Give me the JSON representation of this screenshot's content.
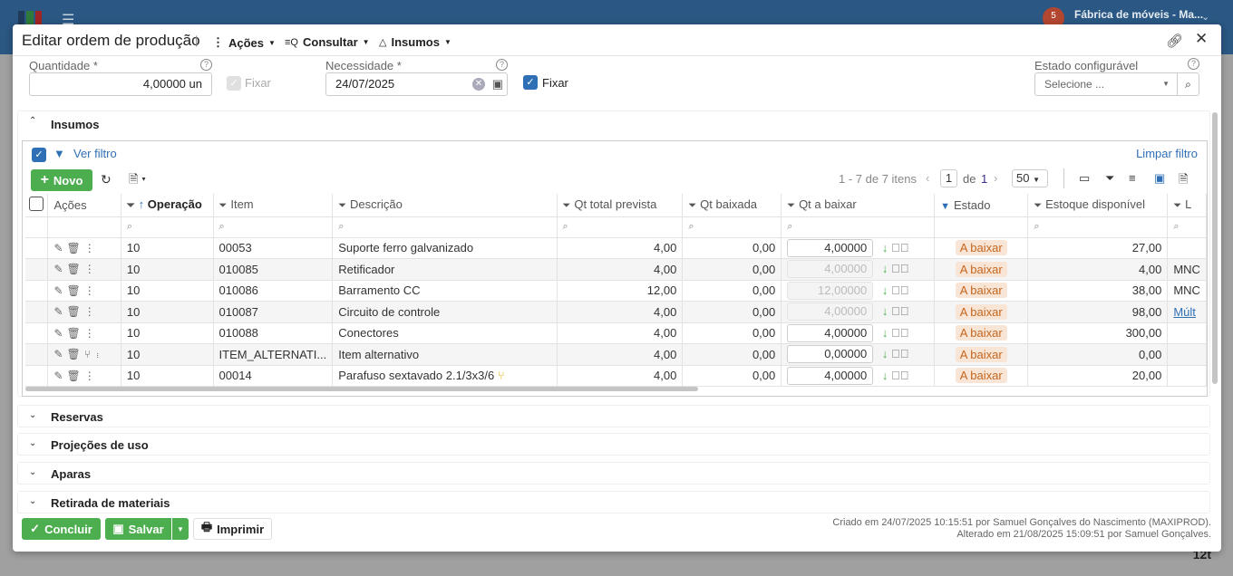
{
  "app": {
    "notifications": "5",
    "company": "Fábrica de móveis - Ma..."
  },
  "background": {
    "number": "12t"
  },
  "modal": {
    "title": "Editar ordem de produção",
    "menu": [
      {
        "label": "Ações"
      },
      {
        "label": "Consultar"
      },
      {
        "label": "Insumos"
      }
    ]
  },
  "form": {
    "quantidade_label": "Quantidade *",
    "quantidade_value": "4,00000 un",
    "fixar1": "Fixar",
    "necessidade_label": "Necessidade *",
    "necessidade_value": "24/07/2025",
    "fixar2": "Fixar",
    "estado_label": "Estado configurável",
    "estado_placeholder": "Selecione ..."
  },
  "insumos": {
    "title": "Insumos",
    "ver_filtro": "Ver filtro",
    "limpar_filtro": "Limpar filtro",
    "novo": "Novo",
    "pager": {
      "range": "1 - 7 de 7 itens",
      "page": "1",
      "of": "de",
      "total": "1",
      "per_page": "50"
    },
    "columns": [
      "Ações",
      "Operação",
      "Item",
      "Descrição",
      "Qt total prevista",
      "Qt baixada",
      "Qt a baixar",
      "Estado",
      "Estoque disponível",
      "L"
    ],
    "rows": [
      {
        "op": "10",
        "item": "00053",
        "desc": "Suporte ferro galvanizado",
        "prev": "4,00",
        "baix": "0,00",
        "abaixar": "4,00000",
        "dis": false,
        "estado": "A baixar",
        "estoque": "27,00",
        "l": ""
      },
      {
        "op": "10",
        "item": "010085",
        "desc": "Retificador",
        "prev": "4,00",
        "baix": "0,00",
        "abaixar": "4,00000",
        "dis": true,
        "estado": "A baixar",
        "estoque": "4,00",
        "l": "MNC"
      },
      {
        "op": "10",
        "item": "010086",
        "desc": "Barramento CC",
        "prev": "12,00",
        "baix": "0,00",
        "abaixar": "12,00000",
        "dis": true,
        "estado": "A baixar",
        "estoque": "38,00",
        "l": "MNC"
      },
      {
        "op": "10",
        "item": "010087",
        "desc": "Circuito de controle",
        "prev": "4,00",
        "baix": "0,00",
        "abaixar": "4,00000",
        "dis": true,
        "estado": "A baixar",
        "estoque": "98,00",
        "l": "Múlt"
      },
      {
        "op": "10",
        "item": "010088",
        "desc": "Conectores",
        "prev": "4,00",
        "baix": "0,00",
        "abaixar": "4,00000",
        "dis": false,
        "estado": "A baixar",
        "estoque": "300,00",
        "l": ""
      },
      {
        "op": "10",
        "item": "ITEM_ALTERNATI...",
        "desc": "Item alternativo",
        "prev": "4,00",
        "baix": "0,00",
        "abaixar": "0,00000",
        "dis": false,
        "estado": "A baixar",
        "estoque": "0,00",
        "l": ""
      },
      {
        "op": "10",
        "item": "00014",
        "desc": "Parafuso sextavado 2.1/3x3/6",
        "prev": "4,00",
        "baix": "0,00",
        "abaixar": "4,00000",
        "dis": false,
        "estado": "A baixar",
        "estoque": "20,00",
        "l": ""
      }
    ]
  },
  "sections": [
    "Reservas",
    "Projeções de uso",
    "Aparas",
    "Retirada de materiais"
  ],
  "footer": {
    "concluir": "Concluir",
    "salvar": "Salvar",
    "imprimir": "Imprimir",
    "criado": "Criado em 24/07/2025 10:15:51 por Samuel Gonçalves do Nascimento (MAXIPROD).",
    "alterado": "Alterado em 21/08/2025 15:09:51 por Samuel Gonçalves."
  },
  "colors": {
    "accent": "#2f6fb5",
    "green": "#4cae4f",
    "badge_bg": "#f9e5d6",
    "badge_fg": "#c4661f",
    "topbar": "#2a5783"
  }
}
